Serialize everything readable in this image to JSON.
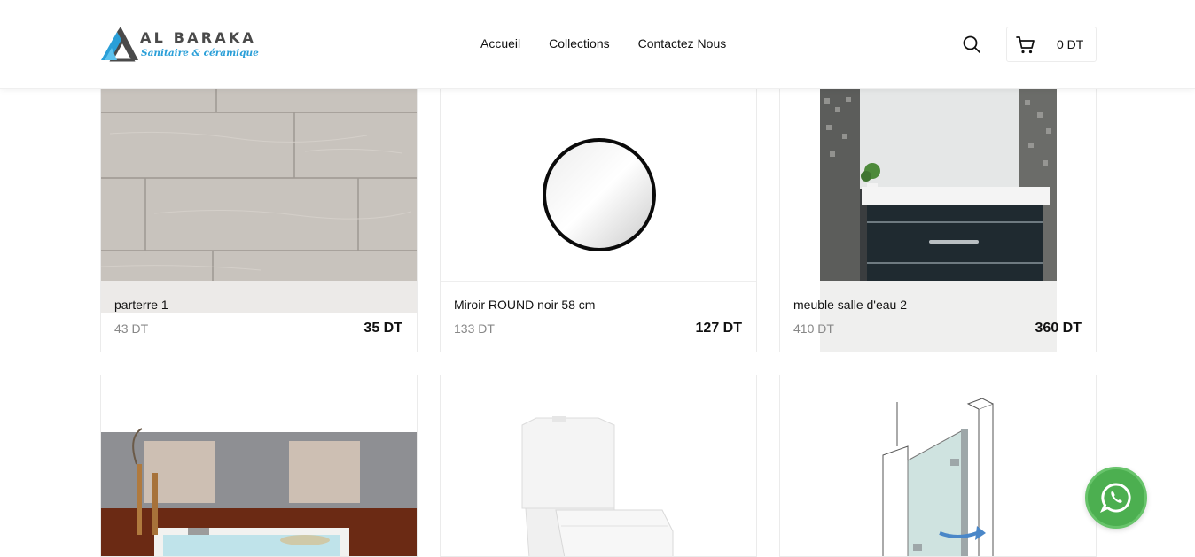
{
  "brand": {
    "name": "AL BARAKA",
    "tagline": "Sanitaire & céramique"
  },
  "nav": [
    {
      "label": "Accueil"
    },
    {
      "label": "Collections"
    },
    {
      "label": "Contactez Nous"
    }
  ],
  "cart": {
    "total": "0 DT"
  },
  "products": [
    {
      "name": "parterre 1",
      "old_price": "43 DT",
      "price": "35 DT"
    },
    {
      "name": "Miroir ROUND noir 58 cm",
      "old_price": "133 DT",
      "price": "127 DT"
    },
    {
      "name": "meuble salle d'eau 2",
      "old_price": "410 DT",
      "price": "360 DT"
    },
    {
      "name": "",
      "old_price": "",
      "price": ""
    },
    {
      "name": "",
      "old_price": "",
      "price": ""
    },
    {
      "name": "",
      "old_price": "",
      "price": ""
    }
  ],
  "colors": {
    "accent": "#2a9fd8",
    "whatsapp": "#4caf50",
    "logo_text": "#4a4a4a"
  },
  "icons": [
    "logo-mark",
    "search-icon",
    "cart-icon",
    "whatsapp-icon"
  ]
}
